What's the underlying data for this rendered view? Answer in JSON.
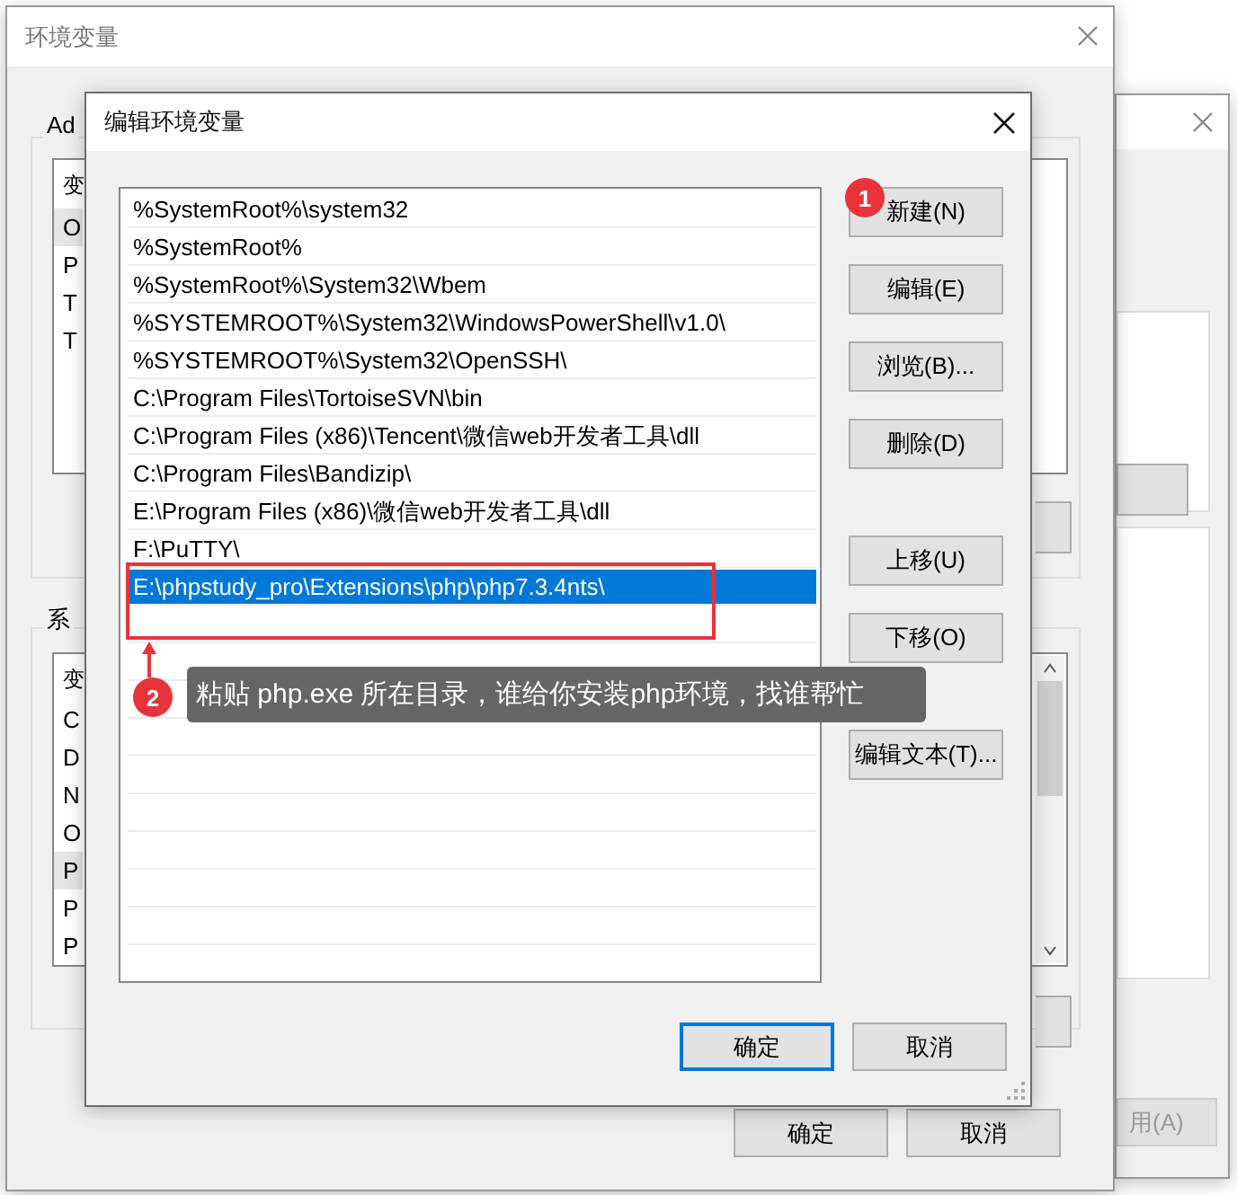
{
  "back_window": {
    "apply_button": {
      "label": "用(A)",
      "disabled": true
    }
  },
  "env_window": {
    "title": "环境变量",
    "user_group": {
      "label": "Ad",
      "list_header": "变",
      "rows": [
        {
          "text": "O",
          "selected": true
        },
        {
          "text": "P",
          "selected": false
        },
        {
          "text": "T",
          "selected": false
        },
        {
          "text": "T",
          "selected": false
        }
      ]
    },
    "system_group": {
      "label": "系",
      "list_header": "变",
      "rows": [
        {
          "text": "C",
          "selected": false
        },
        {
          "text": "D",
          "selected": false
        },
        {
          "text": "N",
          "selected": false
        },
        {
          "text": "O",
          "selected": false
        },
        {
          "text": "P",
          "selected": true
        },
        {
          "text": "P",
          "selected": false
        },
        {
          "text": "P",
          "selected": false
        }
      ]
    },
    "buttons": [
      "确定",
      "取消"
    ]
  },
  "edit_dialog": {
    "title": "编辑环境变量",
    "entries": [
      {
        "text": "%SystemRoot%\\system32",
        "selected": false
      },
      {
        "text": "%SystemRoot%",
        "selected": false
      },
      {
        "text": "%SystemRoot%\\System32\\Wbem",
        "selected": false
      },
      {
        "text": "%SYSTEMROOT%\\System32\\WindowsPowerShell\\v1.0\\",
        "selected": false
      },
      {
        "text": "%SYSTEMROOT%\\System32\\OpenSSH\\",
        "selected": false
      },
      {
        "text": "C:\\Program Files\\TortoiseSVN\\bin",
        "selected": false
      },
      {
        "text": "C:\\Program Files (x86)\\Tencent\\微信web开发者工具\\dll",
        "selected": false
      },
      {
        "text": "C:\\Program Files\\Bandizip\\",
        "selected": false
      },
      {
        "text": "E:\\Program Files (x86)\\微信web开发者工具\\dll",
        "selected": false
      },
      {
        "text": "F:\\PuTTY\\",
        "selected": false
      },
      {
        "text": "E:\\phpstudy_pro\\Extensions\\php\\php7.3.4nts\\",
        "selected": true
      }
    ],
    "button_groups": [
      [
        "新建(N)",
        "编辑(E)",
        "浏览(B)...",
        "删除(D)"
      ],
      [
        "上移(U)",
        "下移(O)"
      ],
      [
        "编辑文本(T)..."
      ]
    ],
    "footer_buttons": [
      {
        "label": "确定",
        "default": true
      },
      {
        "label": "取消",
        "default": false
      }
    ]
  },
  "annotations": [
    {
      "number": "1"
    },
    {
      "number": "2",
      "text": "粘贴 php.exe 所在目录，谁给你安装php环境，找谁帮忙"
    }
  ]
}
